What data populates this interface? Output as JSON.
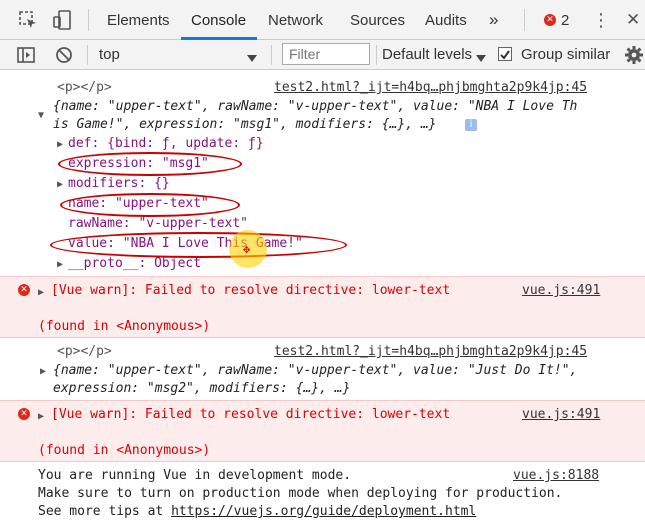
{
  "toolbar": {
    "tabs": [
      "Elements",
      "Console",
      "Network",
      "Sources",
      "Audits"
    ],
    "more": "»",
    "error_count": "2",
    "kebab": "⋮",
    "close": "✕"
  },
  "filterbar": {
    "context": "top",
    "filter_placeholder": "Filter",
    "levels": "Default levels",
    "group_similar": "Group similar"
  },
  "log1": {
    "tag": "<p></p>",
    "source": "test2.html?_ijt=h4bq…phjbmghta2p9k4jp:45",
    "summary_l1": "{name: \"upper-text\", rawName: \"v-upper-text\", value: \"NBA I Love Th",
    "summary_l2": "is Game!\", expression: \"msg1\", modifiers: {…}, …}",
    "props": [
      "def: {bind: ƒ, update: ƒ}",
      "expression: \"msg1\"",
      "modifiers: {}",
      "name: \"upper-text\"",
      "rawName: \"v-upper-text\"",
      "value: \"NBA I Love This Game!\"",
      "__proto__: Object"
    ]
  },
  "warn1": {
    "text": "[Vue warn]: Failed to resolve directive: lower-text",
    "source": "vue.js:491",
    "found": "(found in <Anonymous>)"
  },
  "log2": {
    "tag": "<p></p>",
    "source": "test2.html?_ijt=h4bq…phjbmghta2p9k4jp:45",
    "summary_l1": "{name: \"upper-text\", rawName: \"v-upper-text\", value: \"Just Do It!\",",
    "summary_l2": "expression: \"msg2\", modifiers: {…}, …}"
  },
  "warn2": {
    "text": "[Vue warn]: Failed to resolve directive: lower-text",
    "source": "vue.js:491",
    "found": "(found in <Anonymous>)"
  },
  "info": {
    "l1": "You are running Vue in development mode.",
    "source": "vue.js:8188",
    "l2": "Make sure to turn on production mode when deploying for production.",
    "l3_prefix": "See more tips at ",
    "link": "https://vuejs.org/guide/deployment.html"
  },
  "colors": {
    "accent": "#1a73e8",
    "error": "#e0271a",
    "warn_bg": "#fdecec",
    "string": "#c41a16",
    "key": "#881280"
  }
}
